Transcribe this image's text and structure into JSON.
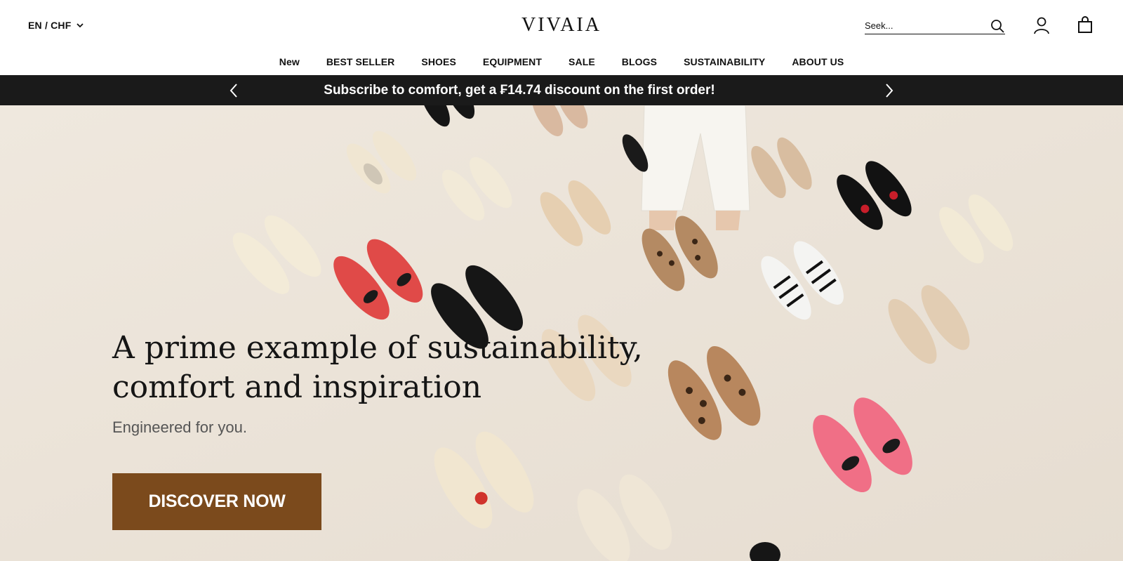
{
  "header": {
    "locale": "EN / CHF",
    "logo": "VIVAIA",
    "search": {
      "placeholder": "Seek..."
    },
    "icons": [
      "chevron-down-icon",
      "search-icon",
      "account-icon",
      "cart-icon"
    ]
  },
  "nav": {
    "items": [
      {
        "label": "New"
      },
      {
        "label": "BEST SELLER"
      },
      {
        "label": "SHOES"
      },
      {
        "label": "EQUIPMENT"
      },
      {
        "label": "SALE"
      },
      {
        "label": "BLOGS"
      },
      {
        "label": "SUSTAINABILITY"
      },
      {
        "label": "ABOUT US"
      }
    ]
  },
  "announcement": {
    "message": "Subscribe to comfort, get a ₣14.74 discount on the first order!",
    "icons": [
      "chevron-left-icon",
      "chevron-right-icon"
    ]
  },
  "hero": {
    "headline": "A prime example of sustainability, comfort and inspiration",
    "subheadline": "Engineered for you.",
    "cta": "DISCOVER NOW"
  },
  "colors": {
    "announcement_bg": "#1a1a1a",
    "hero_bg": "#ece4d9",
    "cta_bg": "#7b4a1c"
  }
}
